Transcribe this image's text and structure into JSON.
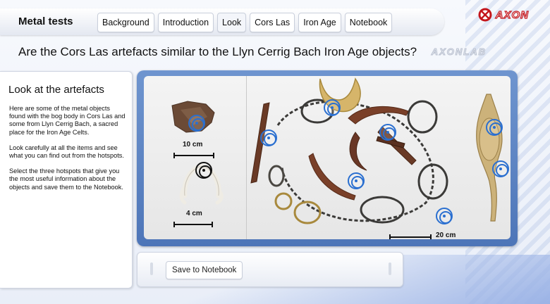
{
  "app": {
    "title": "Metal tests",
    "logo_text": "AXON",
    "watermark": "AXONLAB"
  },
  "tabs": [
    {
      "label": "Background",
      "active": false
    },
    {
      "label": "Introduction",
      "active": false
    },
    {
      "label": "Look",
      "active": true
    },
    {
      "label": "Cors Las",
      "active": false
    },
    {
      "label": "Iron Age",
      "active": false
    },
    {
      "label": "Notebook",
      "active": false
    }
  ],
  "question": "Are the Cors Las artefacts similar to the Llyn Cerrig Bach Iron Age objects?",
  "panel": {
    "title": "Look at the artefacts",
    "paragraphs": [
      "Here are some of the metal objects found with the bog body in Cors Las and some from Llyn Cerrig Bach, a sacred place for the Iron Age Celts.",
      "Look carefully at all the items and see what you can find out from the hotspots.",
      "Select the three hotspots that give you the most useful information about the objects and save them to the Notebook."
    ]
  },
  "viewer": {
    "scales": [
      "10 cm",
      "4 cm",
      "20 cm"
    ]
  },
  "bottom": {
    "save_label": "Save to Notebook"
  },
  "colors": {
    "accent": "#2a6fd0",
    "frame": "#5b82c3",
    "brand": "#c4161c"
  },
  "icons": {
    "hotspot": "hotspot-target-icon",
    "logo": "axon-logo-icon"
  }
}
